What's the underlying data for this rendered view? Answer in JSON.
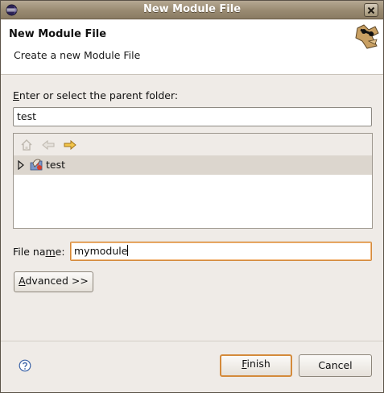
{
  "window": {
    "title": "New Module File",
    "close_label": "×"
  },
  "header": {
    "title": "New Module File",
    "description": "Create a new Module File"
  },
  "parent_folder": {
    "label_mnemonic": "E",
    "label_rest": "nter or select the parent folder:",
    "value": "test"
  },
  "tree": {
    "toolbar": [
      "home-icon",
      "back-icon",
      "forward-icon"
    ],
    "items": [
      {
        "label": "test",
        "icon": "project-icon",
        "expanded": false,
        "selected": true
      }
    ]
  },
  "file_name": {
    "label_pre": "File na",
    "label_mnemonic": "m",
    "label_post": "e:",
    "value": "mymodule"
  },
  "advanced": {
    "label_mnemonic": "A",
    "label_rest": "dvanced >>"
  },
  "footer": {
    "finish_mnemonic": "F",
    "finish_rest": "inish",
    "cancel_label": "Cancel"
  },
  "colors": {
    "titlebar": "#998a71",
    "focus": "#d48a3b",
    "selection": "#dcd6ce"
  }
}
